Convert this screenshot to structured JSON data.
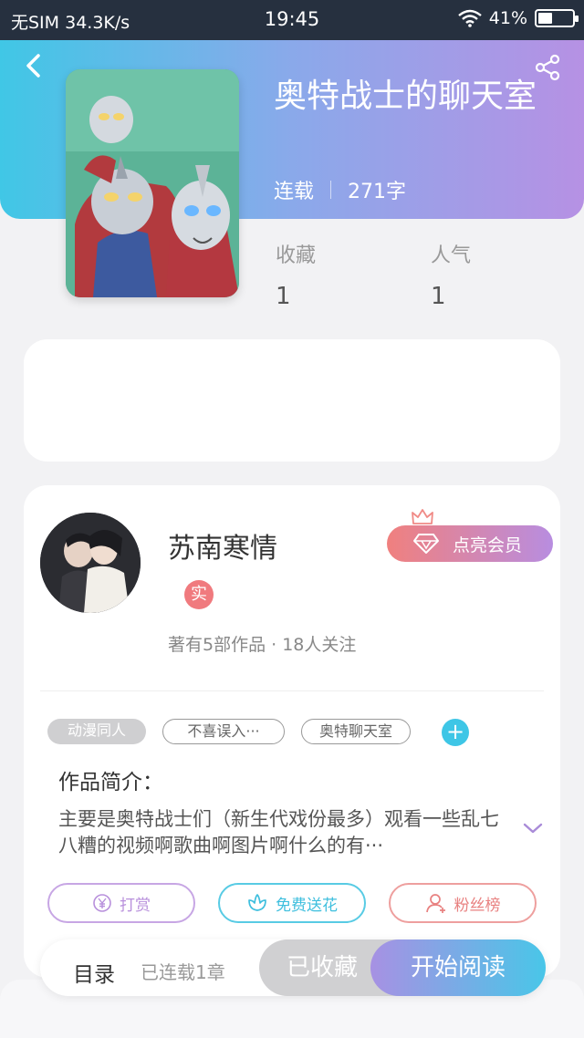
{
  "status_bar": {
    "carrier": "无SIM",
    "speed": "34.3K/s",
    "time": "19:45",
    "battery": "41%",
    "battery_level": 0.41
  },
  "book": {
    "title": "奥特战士的聊天室",
    "status": "连载",
    "word_count": "271字"
  },
  "stats": {
    "favorites_label": "收藏",
    "favorites_value": "1",
    "popularity_label": "人气",
    "popularity_value": "1"
  },
  "author": {
    "name": "苏南寒情",
    "badge": "实",
    "summary": "著有5部作品 · 18人关注",
    "vip_button": "点亮会员"
  },
  "tags": [
    "动漫同人",
    "不喜误入···",
    "奥特聊天室"
  ],
  "add_tag": "+",
  "intro": {
    "label": "作品简介：",
    "text": "主要是奥特战士们（新生代戏份最多）观看一些乱七八糟的视频啊歌曲啊图片啊什么的有···"
  },
  "actions": {
    "reward": "打赏",
    "free_flower": "免费送花",
    "fans_rank": "粉丝榜"
  },
  "bottom_bar": {
    "toc": "目录",
    "chapters": "已连载1章",
    "favorited": "已收藏",
    "start_reading": "开始阅读"
  },
  "colors": {
    "header_start": "#40c7e6",
    "header_end": "#b691e4",
    "reward": "#b890dc",
    "flower": "#45c4e0",
    "fans": "#e88180"
  }
}
